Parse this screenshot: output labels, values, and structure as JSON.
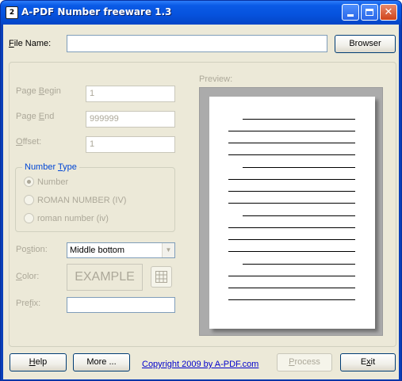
{
  "window": {
    "title": "A-PDF Number freeware 1.3",
    "icon_glyph": "2",
    "controls": [
      "minimize-icon",
      "maximize-icon",
      "close-icon"
    ],
    "close_glyph": "✕"
  },
  "file": {
    "label_prefix": "",
    "label_mnemonic": "F",
    "label_rest": "ile Name:",
    "value": "",
    "browse_label": "Browser"
  },
  "page": {
    "begin_label_pre": "Page ",
    "begin_label_mn": "B",
    "begin_label_post": "egin",
    "begin_value": "1",
    "end_label_pre": "Page ",
    "end_label_mn": "E",
    "end_label_post": "nd",
    "end_value": "999999",
    "offset_label_pre": "",
    "offset_label_mn": "O",
    "offset_label_post": "ffset:",
    "offset_value": "1"
  },
  "number_type": {
    "legend_pre": "Number ",
    "legend_mn": "T",
    "legend_post": "ype",
    "options": [
      "Number",
      "ROMAN NUMBER (IV)",
      "roman number (iv)"
    ],
    "selected": "Number"
  },
  "position": {
    "label_pre": "Po",
    "label_mn": "s",
    "label_post": "tion:",
    "value": "Middle bottom",
    "arrow_icon": "chevron-down-icon"
  },
  "color": {
    "label_pre": "",
    "label_mn": "C",
    "label_post": "olor:",
    "sample_text": "EXAMPLE",
    "picker_icon": "grid-icon"
  },
  "prefix": {
    "label_pre": "Pre",
    "label_mn": "f",
    "label_post": "ix:",
    "value": ""
  },
  "preview": {
    "label": "Preview:"
  },
  "footer": {
    "help_pre": "",
    "help_mn": "H",
    "help_post": "elp",
    "more_label": "More ...",
    "copyright": "Copyright 2009 by A-PDF.com",
    "process_pre": "",
    "process_mn": "P",
    "process_post": "rocess",
    "exit_pre": "E",
    "exit_mn": "x",
    "exit_post": "it"
  },
  "colors": {
    "title_bar": "#0652dd",
    "dialog_bg": "#ece9d8",
    "disabled_text": "#aca899",
    "group_legend": "#0046d5",
    "link": "#0000cc"
  }
}
